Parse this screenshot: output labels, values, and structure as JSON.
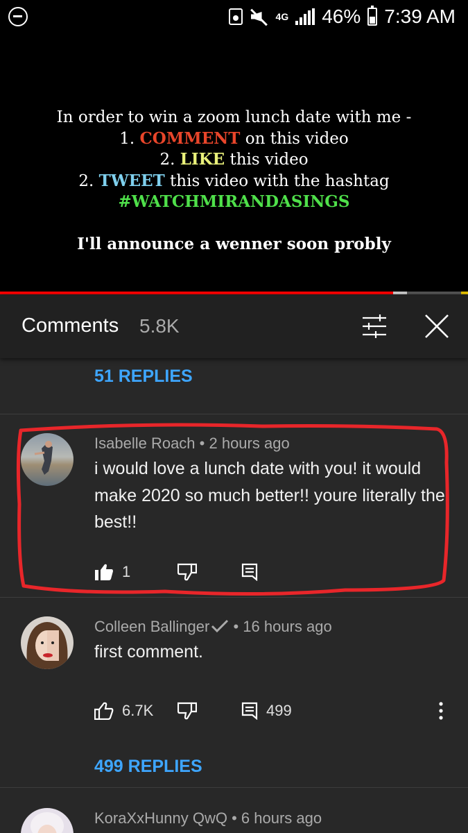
{
  "status_bar": {
    "network": "4G",
    "battery": "46%",
    "time": "7:39 AM"
  },
  "video": {
    "lines": [
      {
        "prefix": "",
        "highlight": "",
        "text": "In order to win a zoom lunch date with me -",
        "color": ""
      },
      {
        "prefix": "1. ",
        "highlight": "COMMENT",
        "text": " on this video",
        "color": "red"
      },
      {
        "prefix": "2. ",
        "highlight": "LIKE",
        "text": " this video",
        "color": "yellow"
      },
      {
        "prefix": "2. ",
        "highlight": "TWEET",
        "text": " this video with the hashtag",
        "color": "blue"
      },
      {
        "prefix": "",
        "highlight": "#WATCHMIRANDASINGS",
        "text": "",
        "color": "green"
      }
    ],
    "announce": "I'll announce a wenner soon probly",
    "progress": 0.84,
    "buffered": 0.03
  },
  "comments_header": {
    "title": "Comments",
    "count": "5.8K"
  },
  "top_replies_link": "51 REPLIES",
  "comments": [
    {
      "author": "Isabelle Roach",
      "time": "2 hours ago",
      "text": "i would love a lunch date with you! it would make 2020 so much better!! youre literally the best!!",
      "likes": "1",
      "liked": true,
      "verified": false
    },
    {
      "author": "Colleen Ballinger",
      "time": "16 hours ago",
      "text": "first comment.",
      "likes": "6.7K",
      "liked": false,
      "verified": true,
      "reply_count": "499",
      "replies_link": "499 REPLIES"
    },
    {
      "author": "KoraXxHunny QwQ",
      "time": "6 hours ago"
    }
  ],
  "colors": {
    "accent_blue": "#3ea6ff",
    "highlight_red": "#e8262a",
    "panel_bg": "#282828"
  }
}
